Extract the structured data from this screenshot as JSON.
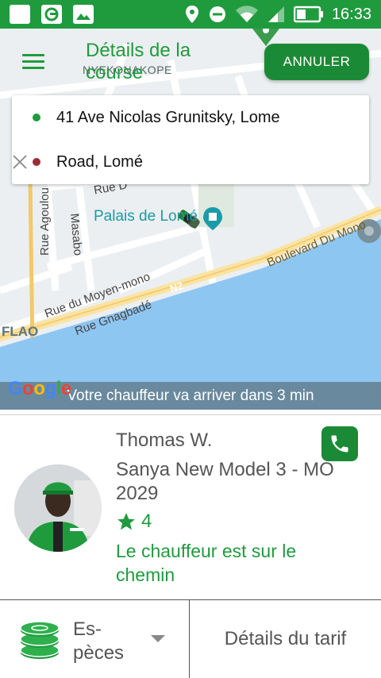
{
  "status_bar": {
    "time": "16:33"
  },
  "header": {
    "title": "Détails de la course",
    "cancel_label": "ANNULER"
  },
  "map": {
    "labels": {
      "nyekonakope": "NYEKONAKOPE",
      "rue_d": "Rue D",
      "rue_agoulou": "Rue Agoulou",
      "masabo": "Masabo",
      "palais": "Palais de Lomé",
      "boulevard": "Boulevard Du Mono",
      "moyen_mono": "Rue du Moyen-mono",
      "gnagbade": "Rue Gnagbadé",
      "n2": "N2",
      "flao": "FLAO",
      "google": "Google"
    }
  },
  "route": {
    "origin": "41 Ave Nicolas Grunitsky, Lome",
    "destination": "Road, Lomé",
    "origin_color": "#1f9b3e",
    "destination_color": "#9b2c36"
  },
  "eta_text": "Votre chauffeur va arriver dans 3 min",
  "driver": {
    "name": "Thomas W.",
    "vehicle": "Sanya New Model 3 - MO 2029",
    "rating": "4",
    "status": "Le chauffeur est sur le chemin"
  },
  "bottom": {
    "payment_label": "Es-pèces",
    "fare_details_label": "Détails du tarif"
  },
  "colors": {
    "brand_green": "#1f9b3e",
    "dark_green": "#1b8a36",
    "water": "#8ec6f2"
  }
}
